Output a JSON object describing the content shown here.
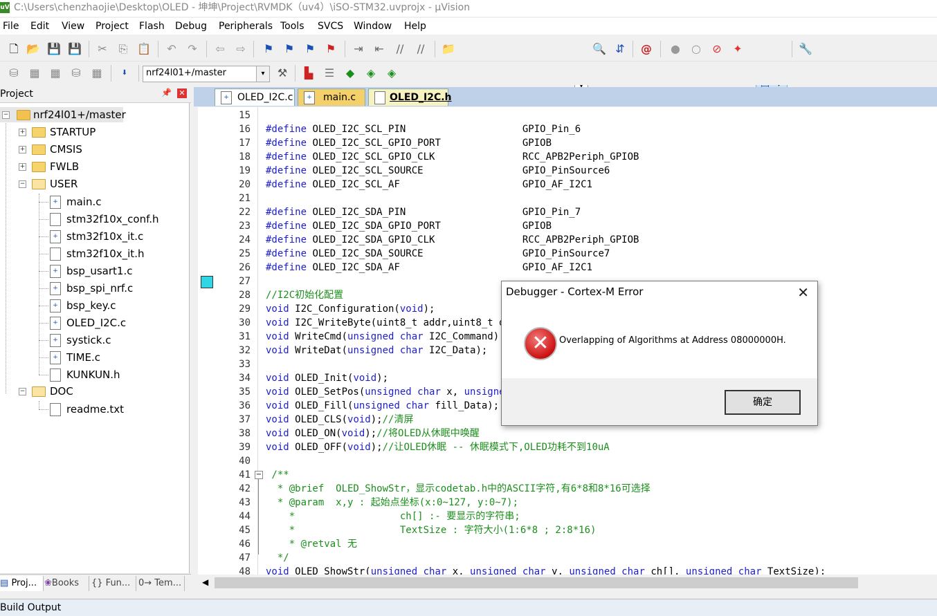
{
  "window": {
    "title": "C:\\Users\\chenzhaojie\\Desktop\\OLED - 坤坤\\Project\\RVMDK（uv4）\\iSO-STM32.uvprojx - µVision",
    "app_icon": "uv4-icon"
  },
  "menu": [
    "File",
    "Edit",
    "View",
    "Project",
    "Flash",
    "Debug",
    "Peripherals",
    "Tools",
    "SVCS",
    "Window",
    "Help"
  ],
  "toolbar2": {
    "target_select": "nrf24l01+/master"
  },
  "project_panel": {
    "title": "Project",
    "pin_icon": "pin-icon",
    "close_icon": "close-icon",
    "root": "nrf24l01+/master",
    "groups": [
      {
        "name": "STARTUP",
        "expanded": false
      },
      {
        "name": "CMSIS",
        "expanded": false
      },
      {
        "name": "FWLB",
        "expanded": false
      },
      {
        "name": "USER",
        "expanded": true,
        "files": [
          "main.c",
          "stm32f10x_conf.h",
          "stm32f10x_it.c",
          "stm32f10x_it.h",
          "bsp_usart1.c",
          "bsp_spi_nrf.c",
          "bsp_key.c",
          "OLED_I2C.c",
          "systick.c",
          "TIME.c",
          "KUNKUN.h"
        ]
      },
      {
        "name": "DOC",
        "expanded": true,
        "files": [
          "readme.txt"
        ]
      }
    ],
    "bottom_tabs": [
      "Proj...",
      "Books",
      "{} Fun...",
      "0→ Tem..."
    ]
  },
  "editor_tabs": [
    {
      "label": "OLED_I2C.c",
      "active": false
    },
    {
      "label": "main.c",
      "active": false
    },
    {
      "label": "OLED_I2C.h",
      "active": true
    }
  ],
  "code_lines": [
    {
      "n": "15",
      "parts": []
    },
    {
      "n": "16",
      "parts": [
        {
          "t": "pp",
          "s": "#define"
        },
        {
          "t": "",
          "s": " OLED_I2C_SCL_PIN                    GPIO_Pin_6"
        }
      ]
    },
    {
      "n": "17",
      "parts": [
        {
          "t": "pp",
          "s": "#define"
        },
        {
          "t": "",
          "s": " OLED_I2C_SCL_GPIO_PORT              GPIOB"
        }
      ]
    },
    {
      "n": "18",
      "parts": [
        {
          "t": "pp",
          "s": "#define"
        },
        {
          "t": "",
          "s": " OLED_I2C_SCL_GPIO_CLK               RCC_APB2Periph_GPIOB"
        }
      ]
    },
    {
      "n": "19",
      "parts": [
        {
          "t": "pp",
          "s": "#define"
        },
        {
          "t": "",
          "s": " OLED_I2C_SCL_SOURCE                 GPIO_PinSource6"
        }
      ]
    },
    {
      "n": "20",
      "parts": [
        {
          "t": "pp",
          "s": "#define"
        },
        {
          "t": "",
          "s": " OLED_I2C_SCL_AF                     GPIO_AF_I2C1"
        }
      ]
    },
    {
      "n": "21",
      "parts": []
    },
    {
      "n": "22",
      "parts": [
        {
          "t": "pp",
          "s": "#define"
        },
        {
          "t": "",
          "s": " OLED_I2C_SDA_PIN                    GPIO_Pin_7"
        }
      ]
    },
    {
      "n": "23",
      "parts": [
        {
          "t": "pp",
          "s": "#define"
        },
        {
          "t": "",
          "s": " OLED_I2C_SDA_GPIO_PORT              GPIOB"
        }
      ]
    },
    {
      "n": "24",
      "parts": [
        {
          "t": "pp",
          "s": "#define"
        },
        {
          "t": "",
          "s": " OLED_I2C_SDA_GPIO_CLK               RCC_APB2Periph_GPIOB"
        }
      ]
    },
    {
      "n": "25",
      "parts": [
        {
          "t": "pp",
          "s": "#define"
        },
        {
          "t": "",
          "s": " OLED_I2C_SDA_SOURCE                 GPIO_PinSource7"
        }
      ]
    },
    {
      "n": "26",
      "parts": [
        {
          "t": "pp",
          "s": "#define"
        },
        {
          "t": "",
          "s": " OLED_I2C_SDA_AF                     GPIO_AF_I2C1"
        }
      ]
    },
    {
      "n": "27",
      "parts": []
    },
    {
      "n": "28",
      "parts": [
        {
          "t": "cm",
          "s": "//I2C初始化配置"
        }
      ]
    },
    {
      "n": "29",
      "parts": [
        {
          "t": "kw",
          "s": "void"
        },
        {
          "t": "",
          "s": " I2C_Configuration("
        },
        {
          "t": "kw",
          "s": "void"
        },
        {
          "t": "",
          "s": ");"
        }
      ]
    },
    {
      "n": "30",
      "parts": [
        {
          "t": "kw",
          "s": "void"
        },
        {
          "t": "",
          "s": " I2C_WriteByte(uint8_t addr,uint8_t data);"
        }
      ]
    },
    {
      "n": "31",
      "parts": [
        {
          "t": "kw",
          "s": "void"
        },
        {
          "t": "",
          "s": " WriteCmd("
        },
        {
          "t": "kw",
          "s": "unsigned char"
        },
        {
          "t": "",
          "s": " I2C_Command);"
        }
      ]
    },
    {
      "n": "32",
      "parts": [
        {
          "t": "kw",
          "s": "void"
        },
        {
          "t": "",
          "s": " WriteDat("
        },
        {
          "t": "kw",
          "s": "unsigned char"
        },
        {
          "t": "",
          "s": " I2C_Data);"
        }
      ]
    },
    {
      "n": "33",
      "parts": []
    },
    {
      "n": "34",
      "parts": [
        {
          "t": "kw",
          "s": "void"
        },
        {
          "t": "",
          "s": " OLED_Init("
        },
        {
          "t": "kw",
          "s": "void"
        },
        {
          "t": "",
          "s": ");"
        }
      ]
    },
    {
      "n": "35",
      "parts": [
        {
          "t": "kw",
          "s": "void"
        },
        {
          "t": "",
          "s": " OLED_SetPos("
        },
        {
          "t": "kw",
          "s": "unsigned char"
        },
        {
          "t": "",
          "s": " x, "
        },
        {
          "t": "kw",
          "s": "unsigned char"
        },
        {
          "t": "",
          "s": " y);"
        }
      ]
    },
    {
      "n": "36",
      "parts": [
        {
          "t": "kw",
          "s": "void"
        },
        {
          "t": "",
          "s": " OLED_Fill("
        },
        {
          "t": "kw",
          "s": "unsigned char"
        },
        {
          "t": "",
          "s": " fill_Data);"
        }
      ]
    },
    {
      "n": "37",
      "parts": [
        {
          "t": "kw",
          "s": "void"
        },
        {
          "t": "",
          "s": " OLED_CLS("
        },
        {
          "t": "kw",
          "s": "void"
        },
        {
          "t": "",
          "s": ");"
        },
        {
          "t": "cm",
          "s": "//清屏"
        }
      ]
    },
    {
      "n": "38",
      "parts": [
        {
          "t": "kw",
          "s": "void"
        },
        {
          "t": "",
          "s": " OLED_ON("
        },
        {
          "t": "kw",
          "s": "void"
        },
        {
          "t": "",
          "s": ");"
        },
        {
          "t": "cm",
          "s": "//将OLED从休眠中唤醒"
        }
      ]
    },
    {
      "n": "39",
      "parts": [
        {
          "t": "kw",
          "s": "void"
        },
        {
          "t": "",
          "s": " OLED_OFF("
        },
        {
          "t": "kw",
          "s": "void"
        },
        {
          "t": "",
          "s": ");"
        },
        {
          "t": "cm",
          "s": "//让OLED休眠 -- 休眠模式下,OLED功耗不到10uA"
        }
      ]
    },
    {
      "n": "40",
      "parts": []
    },
    {
      "n": "41",
      "parts": [
        {
          "t": "cm",
          "s": " /**"
        }
      ]
    },
    {
      "n": "42",
      "parts": [
        {
          "t": "cm",
          "s": "  * @brief  OLED_ShowStr，显示codetab.h中的ASCII字符,有6*8和8*16可选择"
        }
      ]
    },
    {
      "n": "43",
      "parts": [
        {
          "t": "cm",
          "s": "  * @param  x,y : 起始点坐标(x:0~127, y:0~7);"
        }
      ]
    },
    {
      "n": "44",
      "parts": [
        {
          "t": "cm",
          "s": "    *                  ch[] :- 要显示的字符串;"
        }
      ]
    },
    {
      "n": "45",
      "parts": [
        {
          "t": "cm",
          "s": "    *                  TextSize : 字符大小(1:6*8 ; 2:8*16)"
        }
      ]
    },
    {
      "n": "46",
      "parts": [
        {
          "t": "cm",
          "s": "    * @retval 无"
        }
      ]
    },
    {
      "n": "47",
      "parts": [
        {
          "t": "cm",
          "s": "  */"
        }
      ]
    },
    {
      "n": "48",
      "parts": [
        {
          "t": "kw",
          "s": "void"
        },
        {
          "t": "",
          "s": " OLED_ShowStr("
        },
        {
          "t": "kw",
          "s": "unsigned char"
        },
        {
          "t": "",
          "s": " x, "
        },
        {
          "t": "kw",
          "s": "unsigned char"
        },
        {
          "t": "",
          "s": " y, "
        },
        {
          "t": "kw",
          "s": "unsigned char"
        },
        {
          "t": "",
          "s": " ch[], "
        },
        {
          "t": "kw",
          "s": "unsigned char"
        },
        {
          "t": "",
          "s": " TextSize);"
        }
      ]
    }
  ],
  "dialog": {
    "title": "Debugger - Cortex-M Error",
    "message": "Overlapping of Algorithms at Address 08000000H.",
    "ok_label": "确定",
    "icon": "error-icon"
  },
  "build_output": {
    "title": "Build Output"
  },
  "colors": {
    "keyword": "#1d1dcf",
    "comment": "#1b8f1b",
    "tab_active": "#f7f3c0",
    "tab_bg": "#bfd1e8",
    "breakpoint_marker": "#2fd6e6"
  }
}
